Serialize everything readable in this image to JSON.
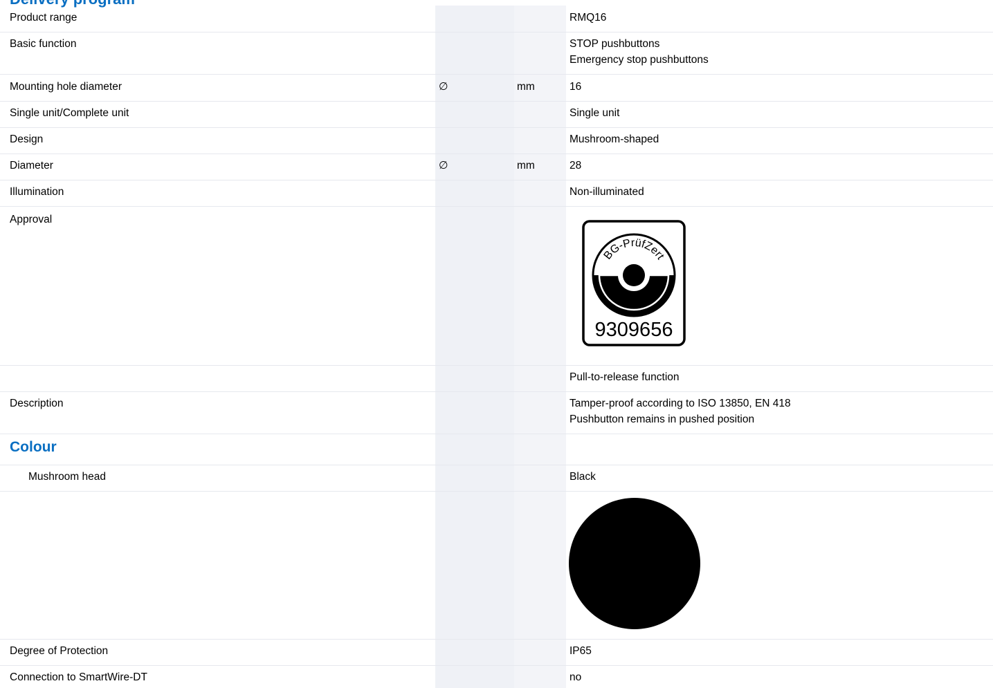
{
  "header": {
    "cut_title": "Delivery program"
  },
  "rows": [
    {
      "label": "Product range",
      "symbol": "",
      "unit": "",
      "value": "RMQ16"
    },
    {
      "label": "Basic function",
      "symbol": "",
      "unit": "",
      "value": "STOP pushbuttons",
      "value2": "Emergency stop pushbuttons"
    },
    {
      "label": "Mounting hole diameter",
      "symbol": "∅",
      "unit": "mm",
      "value": "16"
    },
    {
      "label": "Single unit/Complete unit",
      "symbol": "",
      "unit": "",
      "value": "Single unit"
    },
    {
      "label": "Design",
      "symbol": "",
      "unit": "",
      "value": "Mushroom-shaped"
    },
    {
      "label": "Diameter",
      "symbol": "∅",
      "unit": "mm",
      "value": "28"
    },
    {
      "label": "Illumination",
      "symbol": "",
      "unit": "",
      "value": "Non-illuminated"
    },
    {
      "label": "Approval",
      "symbol": "",
      "unit": "",
      "value": ""
    },
    {
      "label": "",
      "symbol": "",
      "unit": "",
      "value": "Pull-to-release function"
    },
    {
      "label": "Description",
      "symbol": "",
      "unit": "",
      "value": "Tamper-proof according to ISO 13850, EN 418",
      "value2": "Pushbutton remains in pushed position"
    },
    {
      "label": "Mushroom head",
      "symbol": "",
      "unit": "",
      "value": "Black"
    },
    {
      "label": "Degree of Protection",
      "symbol": "",
      "unit": "",
      "value": "IP65"
    },
    {
      "label": "Connection to SmartWire-DT",
      "symbol": "",
      "unit": "",
      "value": "no"
    }
  ],
  "sections": {
    "colour": "Colour"
  },
  "approval_logo": {
    "text": "BG-PrüfZert",
    "number": "9309656",
    "icon": "bg-pruefzert-approval-mark"
  },
  "colour_swatch": {
    "icon": "colour-swatch-black-circle",
    "color": "#000000"
  }
}
